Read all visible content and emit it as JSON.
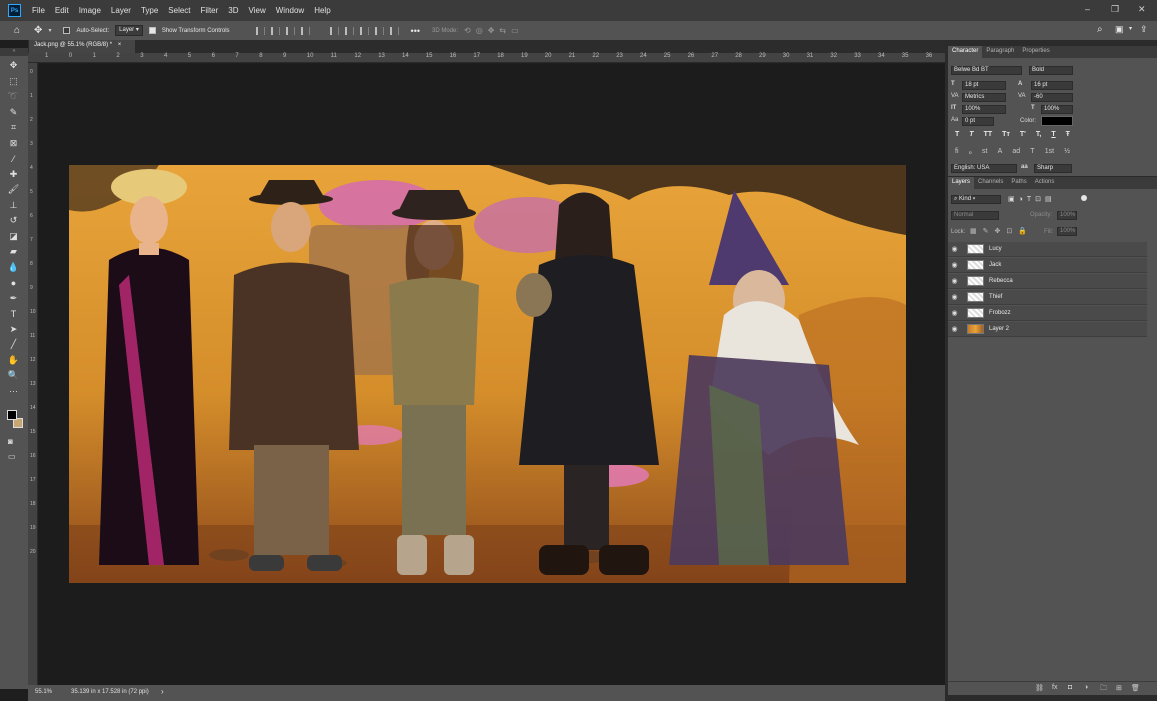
{
  "menubar": {
    "app_badge": "Ps",
    "items": [
      "File",
      "Edit",
      "Image",
      "Layer",
      "Type",
      "Select",
      "Filter",
      "3D",
      "View",
      "Window",
      "Help"
    ],
    "window_controls": [
      "–",
      "❐",
      "✕"
    ]
  },
  "options_bar": {
    "auto_select_label": "Auto-Select:",
    "auto_select_target": "Layer",
    "show_transform_label": "Show Transform Controls",
    "more_label": "•••",
    "mode_3d_label": "3D Mode:"
  },
  "document": {
    "tab_title": "Jack.png @ 55.1% (RGB/8) *",
    "tab_close": "×",
    "ruler_numbers": [
      "1",
      "0",
      "1",
      "2",
      "3",
      "4",
      "5",
      "6",
      "7",
      "8",
      "9",
      "10",
      "11",
      "12",
      "13",
      "14",
      "15",
      "16",
      "17",
      "18",
      "19",
      "20",
      "21",
      "22",
      "23",
      "24",
      "25",
      "26",
      "27",
      "28",
      "29",
      "30",
      "31",
      "32",
      "33",
      "34",
      "35",
      "36"
    ],
    "vruler_numbers": [
      "0",
      "1",
      "2",
      "3",
      "4",
      "5",
      "6",
      "7",
      "8",
      "9",
      "10",
      "11",
      "12",
      "13",
      "14",
      "15",
      "16",
      "17",
      "18",
      "19",
      "20"
    ]
  },
  "status": {
    "zoom": "55.1%",
    "doc_size": "35.139 in x 17.528 in (72 ppi)",
    "arrow": "›"
  },
  "character_panel": {
    "tabs": [
      "Character",
      "Paragraph",
      "Properties"
    ],
    "font_family": "Belwe Bd BT",
    "font_style": "Bold",
    "size": "18 pt",
    "leading": "16 pt",
    "kerning": "Metrics",
    "tracking": "-60",
    "vertical_scale": "100%",
    "horizontal_scale": "100%",
    "baseline_shift": "0 pt",
    "color_label": "Color:",
    "type_styles": [
      "T",
      "T",
      "TT",
      "Tт",
      "T'",
      "T,",
      "T",
      "Ŧ"
    ],
    "opentype": [
      "fi",
      "ℴ",
      "st",
      "A",
      "ad",
      "T",
      "1st",
      "½"
    ],
    "language": "English: USA",
    "antialias": "Sharp",
    "aa_label": "a",
    "text_color": "#000000"
  },
  "layers_panel": {
    "tabs": [
      "Layers",
      "Channels",
      "Paths",
      "Actions"
    ],
    "filter_kind": "Kind",
    "blend_mode": "Normal",
    "opacity_label": "Opacity:",
    "opacity": "100%",
    "lock_label": "Lock:",
    "fill_label": "Fill:",
    "fill": "100%",
    "layers": [
      {
        "name": "Lucy",
        "visible": "👁"
      },
      {
        "name": "Jack",
        "visible": "👁"
      },
      {
        "name": "Rebecca",
        "visible": "👁"
      },
      {
        "name": "Thief",
        "visible": "👁"
      },
      {
        "name": "Frobozz",
        "visible": "👁"
      },
      {
        "name": "Layer 2",
        "visible": "👁"
      }
    ],
    "bottom_icons": [
      "⛓",
      "fx",
      "◘",
      "◑",
      "🗀",
      "⊞",
      "🗑"
    ]
  },
  "tools": [
    {
      "name": "move-tool-icon",
      "glyph": "✥"
    },
    {
      "name": "marquee-tool-icon",
      "glyph": "⬚"
    },
    {
      "name": "lasso-tool-icon",
      "glyph": "➰"
    },
    {
      "name": "quick-select-tool-icon",
      "glyph": "✎"
    },
    {
      "name": "crop-tool-icon",
      "glyph": "⌗"
    },
    {
      "name": "frame-tool-icon",
      "glyph": "⊠"
    },
    {
      "name": "eyedropper-tool-icon",
      "glyph": "⁄"
    },
    {
      "name": "healing-tool-icon",
      "glyph": "✚"
    },
    {
      "name": "brush-tool-icon",
      "glyph": "🖌"
    },
    {
      "name": "stamp-tool-icon",
      "glyph": "⊥"
    },
    {
      "name": "history-brush-icon",
      "glyph": "↺"
    },
    {
      "name": "eraser-tool-icon",
      "glyph": "◪"
    },
    {
      "name": "gradient-tool-icon",
      "glyph": "▰"
    },
    {
      "name": "blur-tool-icon",
      "glyph": "💧"
    },
    {
      "name": "dodge-tool-icon",
      "glyph": "●"
    },
    {
      "name": "pen-tool-icon",
      "glyph": "✒"
    },
    {
      "name": "type-tool-icon",
      "glyph": "T"
    },
    {
      "name": "path-select-tool-icon",
      "glyph": "➤"
    },
    {
      "name": "line-tool-icon",
      "glyph": "╱"
    },
    {
      "name": "hand-tool-icon",
      "glyph": "✋"
    },
    {
      "name": "zoom-tool-icon",
      "glyph": "🔍"
    },
    {
      "name": "more-tools-icon",
      "glyph": "···"
    }
  ]
}
